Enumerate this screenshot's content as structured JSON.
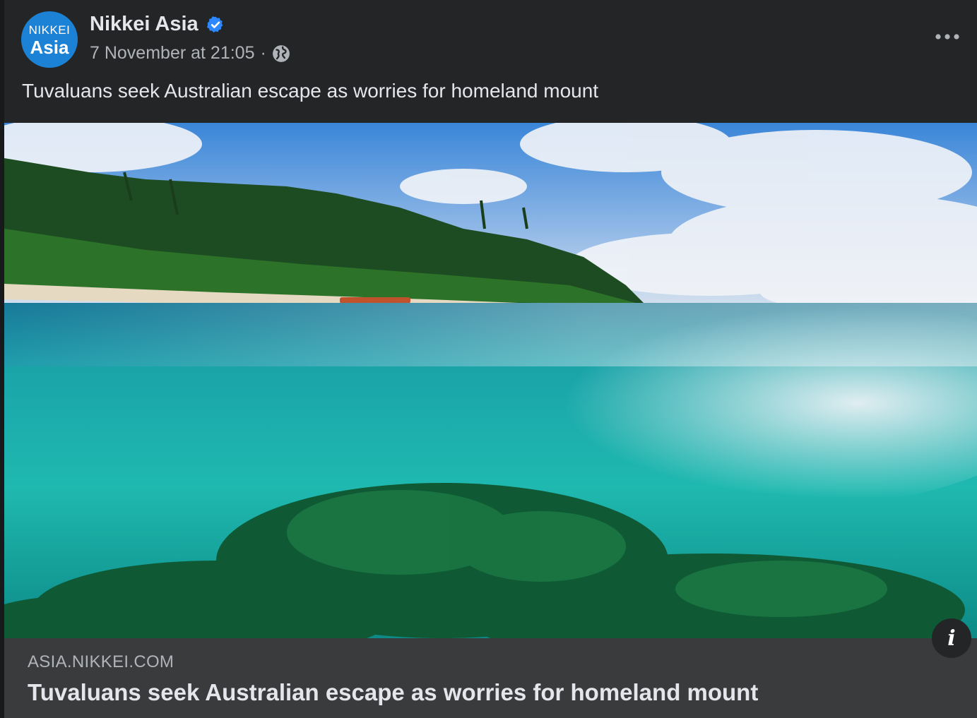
{
  "post": {
    "page_name": "Nikkei Asia",
    "avatar_line1": "NIKKEI",
    "avatar_line2": "Asia",
    "timestamp": "7 November at 21:05",
    "separator": "·",
    "audience_icon": "globe-icon",
    "verified_icon": "verified-badge-icon",
    "more_icon": "more-options-icon",
    "text": "Tuvaluans seek Australian escape as worries for homeland mount"
  },
  "link_preview": {
    "domain": "ASIA.NIKKEI.COM",
    "headline": "Tuvaluans seek Australian escape as worries for homeland mount",
    "info_label": "i",
    "info_icon": "info-icon"
  },
  "colors": {
    "card_bg": "#242526",
    "footer_bg": "#3a3b3c",
    "brand_blue": "#1b82d6",
    "primary_text": "#e4e6eb",
    "secondary_text": "#b0b3b8"
  }
}
